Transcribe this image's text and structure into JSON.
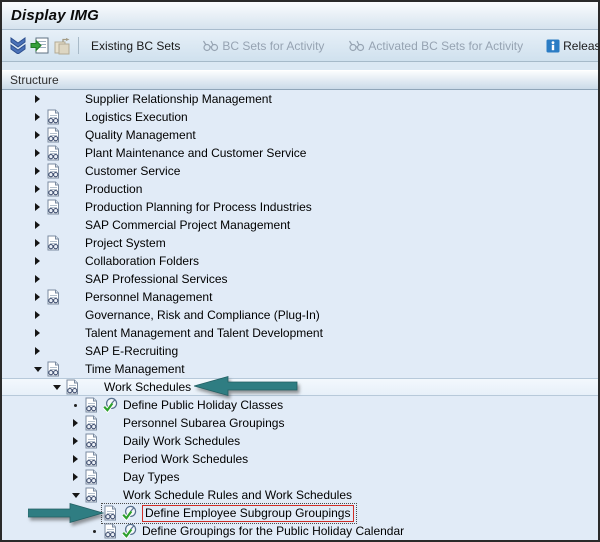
{
  "window": {
    "title": "Display IMG"
  },
  "toolbar": {
    "icons": [
      {
        "name": "expand-collapse-chevrons-icon"
      },
      {
        "name": "position-in-structure-icon"
      },
      {
        "name": "copy-icon"
      }
    ],
    "buttons": [
      {
        "label": "Existing BC Sets",
        "enabled": true,
        "icon": "none"
      },
      {
        "label": "BC Sets for Activity",
        "enabled": false,
        "icon": "glasses"
      },
      {
        "label": "Activated BC Sets for Activity",
        "enabled": false,
        "icon": "glasses"
      },
      {
        "label": "Release",
        "enabled": true,
        "icon": "info"
      }
    ]
  },
  "structure": {
    "label": "Structure"
  },
  "tree": {
    "rows": [
      {
        "label": "Supplier Relationship Management",
        "level": 0,
        "expander": "collapsed",
        "doc": false,
        "activity": false
      },
      {
        "label": "Logistics Execution",
        "level": 0,
        "expander": "collapsed",
        "doc": true,
        "activity": false
      },
      {
        "label": "Quality Management",
        "level": 0,
        "expander": "collapsed",
        "doc": true,
        "activity": false
      },
      {
        "label": "Plant Maintenance and Customer Service",
        "level": 0,
        "expander": "collapsed",
        "doc": true,
        "activity": false
      },
      {
        "label": "Customer Service",
        "level": 0,
        "expander": "collapsed",
        "doc": true,
        "activity": false
      },
      {
        "label": "Production",
        "level": 0,
        "expander": "collapsed",
        "doc": true,
        "activity": false
      },
      {
        "label": "Production Planning for Process Industries",
        "level": 0,
        "expander": "collapsed",
        "doc": true,
        "activity": false
      },
      {
        "label": "SAP Commercial Project Management",
        "level": 0,
        "expander": "collapsed",
        "doc": false,
        "activity": false
      },
      {
        "label": "Project System",
        "level": 0,
        "expander": "collapsed",
        "doc": true,
        "activity": false
      },
      {
        "label": "Collaboration Folders",
        "level": 0,
        "expander": "collapsed",
        "doc": false,
        "activity": false
      },
      {
        "label": "SAP Professional Services",
        "level": 0,
        "expander": "collapsed",
        "doc": false,
        "activity": false
      },
      {
        "label": "Personnel Management",
        "level": 0,
        "expander": "collapsed",
        "doc": true,
        "activity": false
      },
      {
        "label": "Governance, Risk and Compliance (Plug-In)",
        "level": 0,
        "expander": "collapsed",
        "doc": false,
        "activity": false
      },
      {
        "label": "Talent Management and Talent Development",
        "level": 0,
        "expander": "collapsed",
        "doc": false,
        "activity": false
      },
      {
        "label": "SAP E-Recruiting",
        "level": 0,
        "expander": "collapsed",
        "doc": false,
        "activity": false
      },
      {
        "label": "Time Management",
        "level": 0,
        "expander": "expanded",
        "doc": true,
        "activity": false
      },
      {
        "label": "Work Schedules",
        "level": 1,
        "expander": "expanded",
        "doc": true,
        "activity": false,
        "selected": true,
        "annotation": "arrow-left"
      },
      {
        "label": "Define Public Holiday Classes",
        "level": 2,
        "expander": "bullet",
        "doc": true,
        "activity": true
      },
      {
        "label": "Personnel Subarea Groupings",
        "level": 2,
        "expander": "collapsed",
        "doc": true,
        "activity": false
      },
      {
        "label": "Daily Work Schedules",
        "level": 2,
        "expander": "collapsed",
        "doc": true,
        "activity": false
      },
      {
        "label": "Period Work Schedules",
        "level": 2,
        "expander": "collapsed",
        "doc": true,
        "activity": false
      },
      {
        "label": "Day Types",
        "level": 2,
        "expander": "collapsed",
        "doc": true,
        "activity": false
      },
      {
        "label": "Work Schedule Rules and Work Schedules",
        "level": 2,
        "expander": "expanded",
        "doc": true,
        "activity": false
      },
      {
        "label": "Define Employee Subgroup Groupings",
        "level": 3,
        "expander": "none",
        "doc": true,
        "activity": true,
        "red_box": true,
        "focus_dotted": true,
        "annotation": "arrow-right"
      },
      {
        "label": "Define Groupings for the Public Holiday Calendar",
        "level": 3,
        "expander": "bullet",
        "doc": true,
        "activity": true
      }
    ]
  },
  "colors": {
    "annotation_arrow": "#2f7d82",
    "highlight_box": "#cf2d26",
    "selected_row_bg": "#edf4fb",
    "tree_bg": "#e1ebf7",
    "toolbar_bg": "#d8e6f2"
  }
}
